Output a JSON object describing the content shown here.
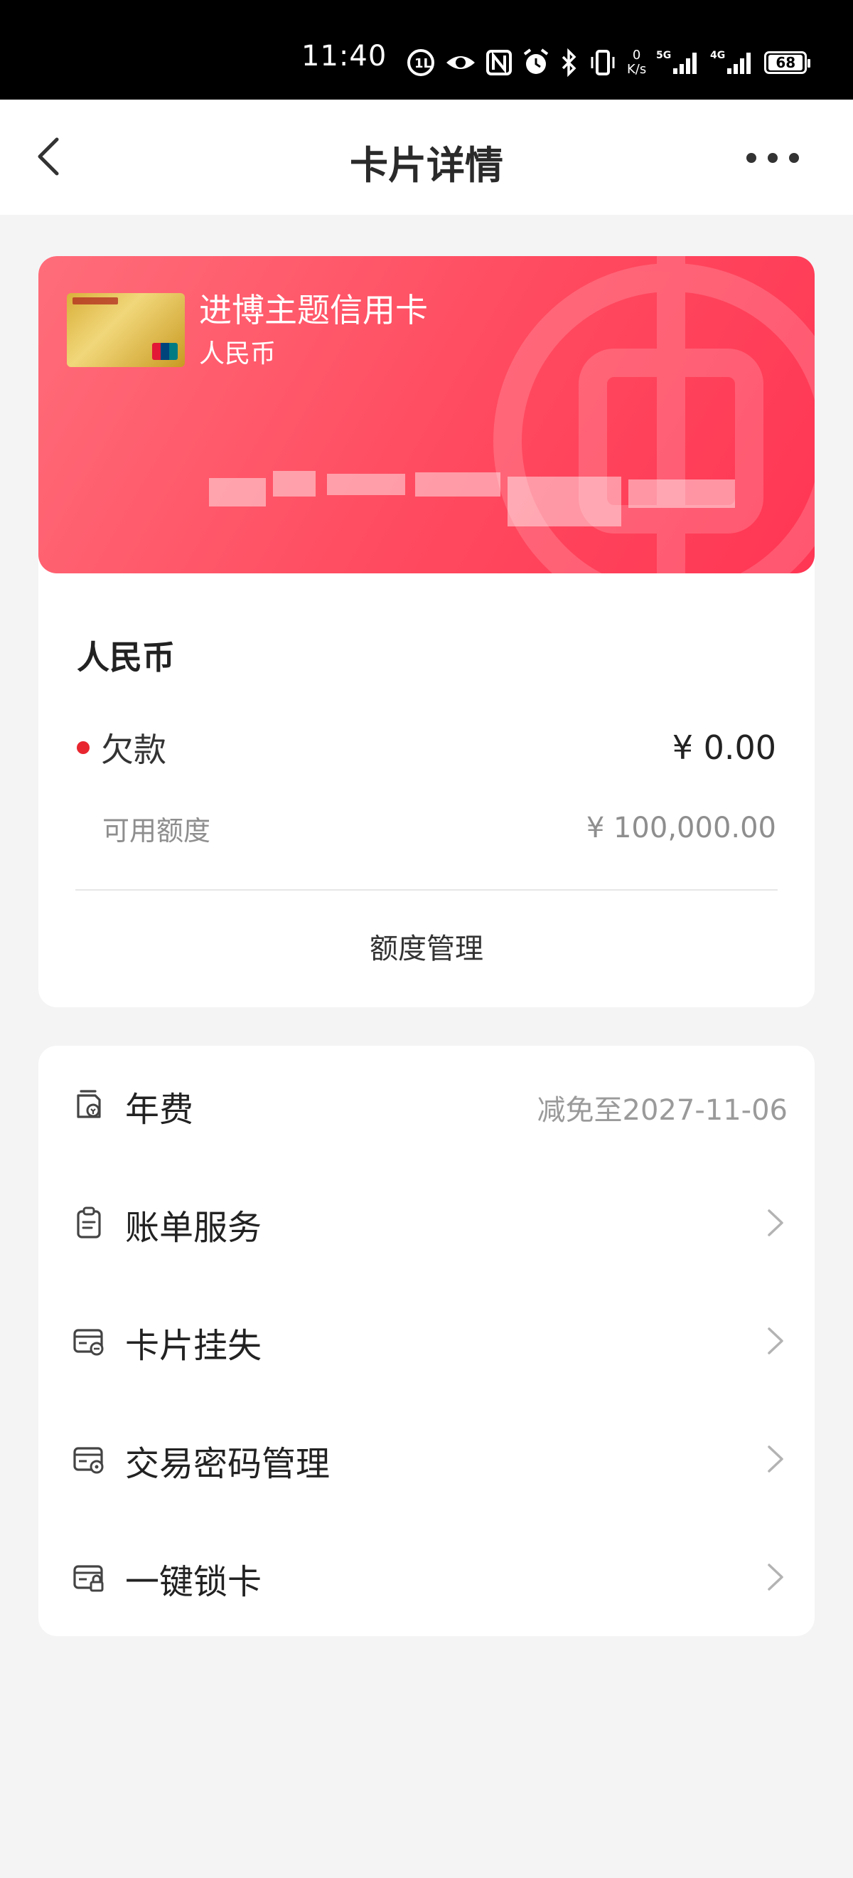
{
  "status_bar": {
    "time": "11:40",
    "net_speed_value": "0",
    "net_speed_unit": "K/s",
    "signal_1": "5G",
    "signal_2": "4G",
    "battery": "68"
  },
  "nav": {
    "title": "卡片详情"
  },
  "card": {
    "name": "进博主题信用卡",
    "currency": "人民币"
  },
  "summary": {
    "title": "人民币",
    "debt_label": "欠款",
    "debt_value": "¥ 0.00",
    "limit_label": "可用额度",
    "limit_value": "¥ 100,000.00",
    "manage_label": "额度管理"
  },
  "menu": {
    "annual_fee_label": "年费",
    "annual_fee_value": "减免至2027-11-06",
    "bill_service_label": "账单服务",
    "report_loss_label": "卡片挂失",
    "password_label": "交易密码管理",
    "lock_card_label": "一键锁卡"
  },
  "colors": {
    "card_gradient_start": "#ff6d7a",
    "card_gradient_end": "#ff3654",
    "debt_dot": "#e8262f",
    "page_bg": "#f4f4f5"
  }
}
